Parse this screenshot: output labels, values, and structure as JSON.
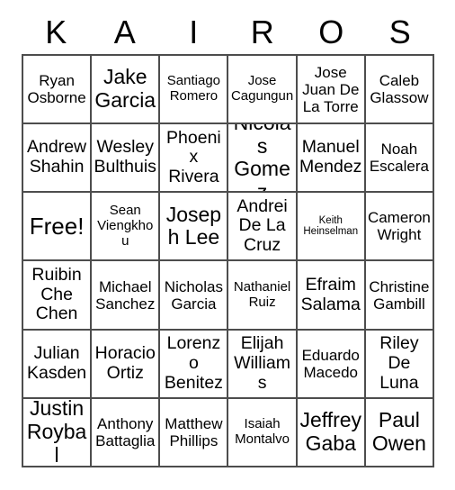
{
  "card": {
    "title_letters": [
      "K",
      "A",
      "I",
      "R",
      "O",
      "S"
    ],
    "free_label": "Free!",
    "border_color": "#4d4d4d",
    "background_color": "#ffffff",
    "text_color": "#000000",
    "columns": 6,
    "rows": 6,
    "cells": [
      [
        {
          "text": "Ryan Osborne",
          "size": "md"
        },
        {
          "text": "Jake Garcia",
          "size": "xl"
        },
        {
          "text": "Santiago Romero",
          "size": "sm"
        },
        {
          "text": "Jose Cagungun",
          "size": "sm"
        },
        {
          "text": "Jose Juan De La Torre",
          "size": "md"
        },
        {
          "text": "Caleb Glassow",
          "size": "md"
        }
      ],
      [
        {
          "text": "Andrew Shahin",
          "size": "lg"
        },
        {
          "text": "Wesley Bulthuis",
          "size": "lg"
        },
        {
          "text": "Phoenix Rivera",
          "size": "lg"
        },
        {
          "text": "Nicolas Gomez",
          "size": "xl"
        },
        {
          "text": "Manuel Mendez",
          "size": "lg"
        },
        {
          "text": "Noah Escalera",
          "size": "md"
        }
      ],
      [
        {
          "text": "Free!",
          "size": "free"
        },
        {
          "text": "Sean Viengkhou",
          "size": "sm"
        },
        {
          "text": "Joseph Lee",
          "size": "xl"
        },
        {
          "text": "Andrei De La Cruz",
          "size": "lg"
        },
        {
          "text": "Keith Heinselman",
          "size": "xs"
        },
        {
          "text": "Cameron Wright",
          "size": "md"
        }
      ],
      [
        {
          "text": "Ruibin Che Chen",
          "size": "lg"
        },
        {
          "text": "Michael Sanchez",
          "size": "md"
        },
        {
          "text": "Nicholas Garcia",
          "size": "md"
        },
        {
          "text": "Nathaniel Ruiz",
          "size": "sm"
        },
        {
          "text": "Efraim Salama",
          "size": "lg"
        },
        {
          "text": "Christine Gambill",
          "size": "md"
        }
      ],
      [
        {
          "text": "Julian Kasden",
          "size": "lg"
        },
        {
          "text": "Horacio Ortiz",
          "size": "lg"
        },
        {
          "text": "Lorenzo Benitez",
          "size": "lg"
        },
        {
          "text": "Elijah Williams",
          "size": "lg"
        },
        {
          "text": "Eduardo Macedo",
          "size": "md"
        },
        {
          "text": "Riley De Luna",
          "size": "lg"
        }
      ],
      [
        {
          "text": "Justin Roybal",
          "size": "xl"
        },
        {
          "text": "Anthony Battaglia",
          "size": "md"
        },
        {
          "text": "Matthew Phillips",
          "size": "md"
        },
        {
          "text": "Isaiah Montalvo",
          "size": "sm"
        },
        {
          "text": "Jeffrey Gaba",
          "size": "xl"
        },
        {
          "text": "Paul Owen",
          "size": "xl"
        }
      ]
    ]
  }
}
